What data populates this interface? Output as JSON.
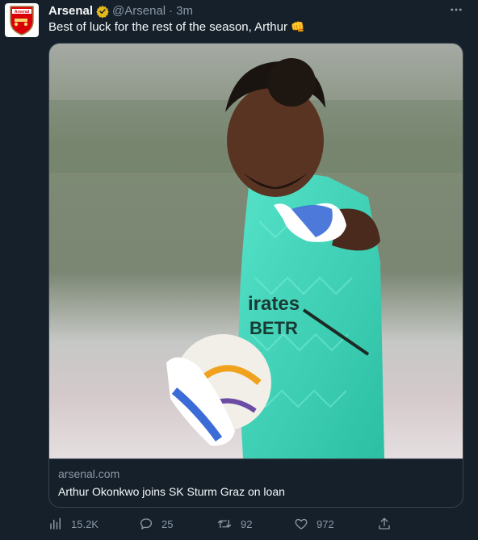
{
  "account": {
    "name": "Arsenal",
    "handle": "@Arsenal",
    "separator": "·",
    "time": "3m",
    "avatar_text": "Arsenal"
  },
  "tweet": {
    "text": "Best of luck for the rest of the season, Arthur",
    "emoji": "👊"
  },
  "card": {
    "domain": "arsenal.com",
    "title": "Arthur Okonkwo joins SK Sturm Graz on loan",
    "shirt_text_1": "irates",
    "shirt_text_2": "BETR"
  },
  "stats": {
    "views": "15.2K",
    "replies": "25",
    "retweets": "92",
    "likes": "972"
  },
  "colors": {
    "background": "#15202b",
    "border": "#38444d",
    "muted_text": "#8b98a5",
    "verified_gold": "#e2b719",
    "kit_green": "#3fd3b8"
  },
  "icons": [
    "verified-badge-icon",
    "more-icon",
    "views-icon",
    "reply-icon",
    "retweet-icon",
    "like-icon",
    "share-icon"
  ]
}
